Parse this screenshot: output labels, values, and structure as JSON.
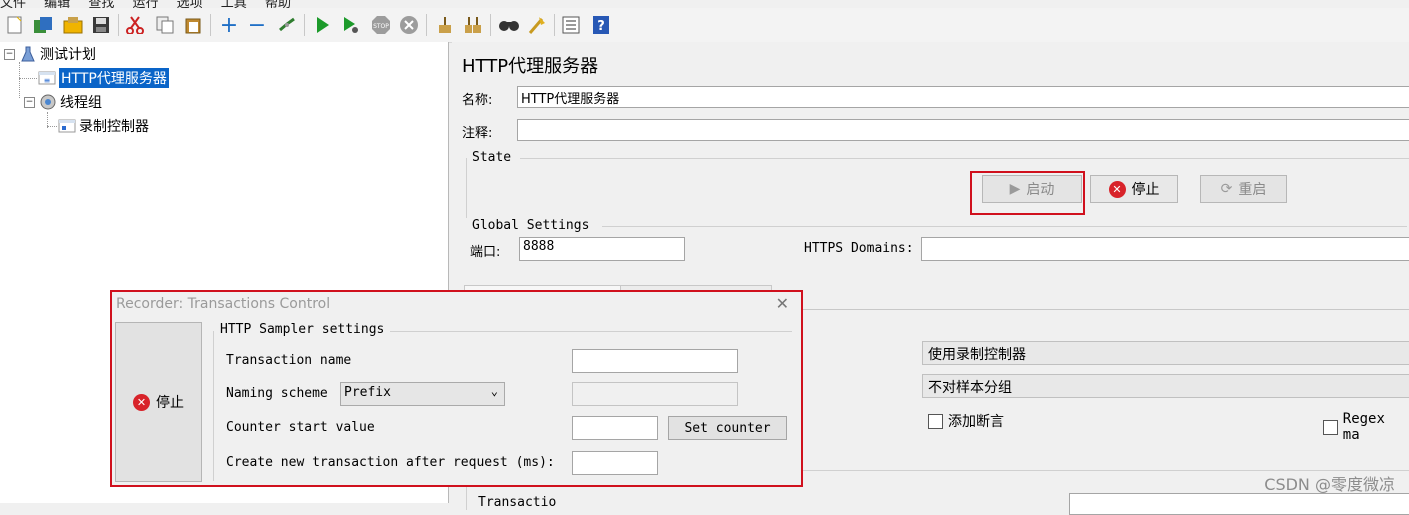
{
  "menubar": {
    "items": [
      "文件",
      "编辑",
      "查找",
      "运行",
      "选项",
      "工具",
      "帮助"
    ]
  },
  "toolbar": {
    "icons": [
      "new-icon",
      "templates-icon",
      "open-icon",
      "save-icon",
      "cut-icon",
      "copy-icon",
      "paste-icon",
      "expand-icon",
      "collapse-icon",
      "toggle-icon",
      "start-icon",
      "start-no-pause-icon",
      "stop-icon",
      "shutdown-icon",
      "clear-icon",
      "clear-all-icon",
      "search-icon",
      "reset-search-icon",
      "function-helper-icon",
      "help-icon"
    ]
  },
  "tree": {
    "items": [
      {
        "label": "测试计划"
      },
      {
        "label": "HTTP代理服务器"
      },
      {
        "label": "线程组"
      },
      {
        "label": "录制控制器"
      }
    ]
  },
  "panel": {
    "title": "HTTP代理服务器",
    "name_label": "名称:",
    "name_value": "HTTP代理服务器",
    "comment_label": "注释:",
    "comment_value": "",
    "state_label": "State",
    "start_label": "启动",
    "stop_label": "停止",
    "restart_label": "重启",
    "global_label": "Global Settings",
    "port_label": "端口:",
    "port_value": "8888",
    "https_label": "HTTPS Domains:",
    "https_value": "",
    "target_controller": "使用录制控制器",
    "grouping": "不对样本分组",
    "add_assertions": "添加断言",
    "regex_matching": "Regex ma",
    "partial_label": "Transactio"
  },
  "dialog": {
    "title": "Recorder: Transactions Control",
    "stop_label": "停止",
    "group_label": "HTTP Sampler settings",
    "transaction_name_label": "Transaction name",
    "transaction_name_value": "",
    "naming_scheme_label": "Naming scheme",
    "naming_scheme_value": "Prefix",
    "counter_start_label": "Counter start value",
    "counter_start_value": "",
    "set_counter_label": "Set counter",
    "create_after_label": "Create new transaction after request (ms):",
    "create_after_value": ""
  },
  "watermark": "CSDN @零度微凉",
  "colors": {
    "highlight": "#d0101d",
    "selection": "#0a64c8",
    "stop": "#d8232a"
  }
}
